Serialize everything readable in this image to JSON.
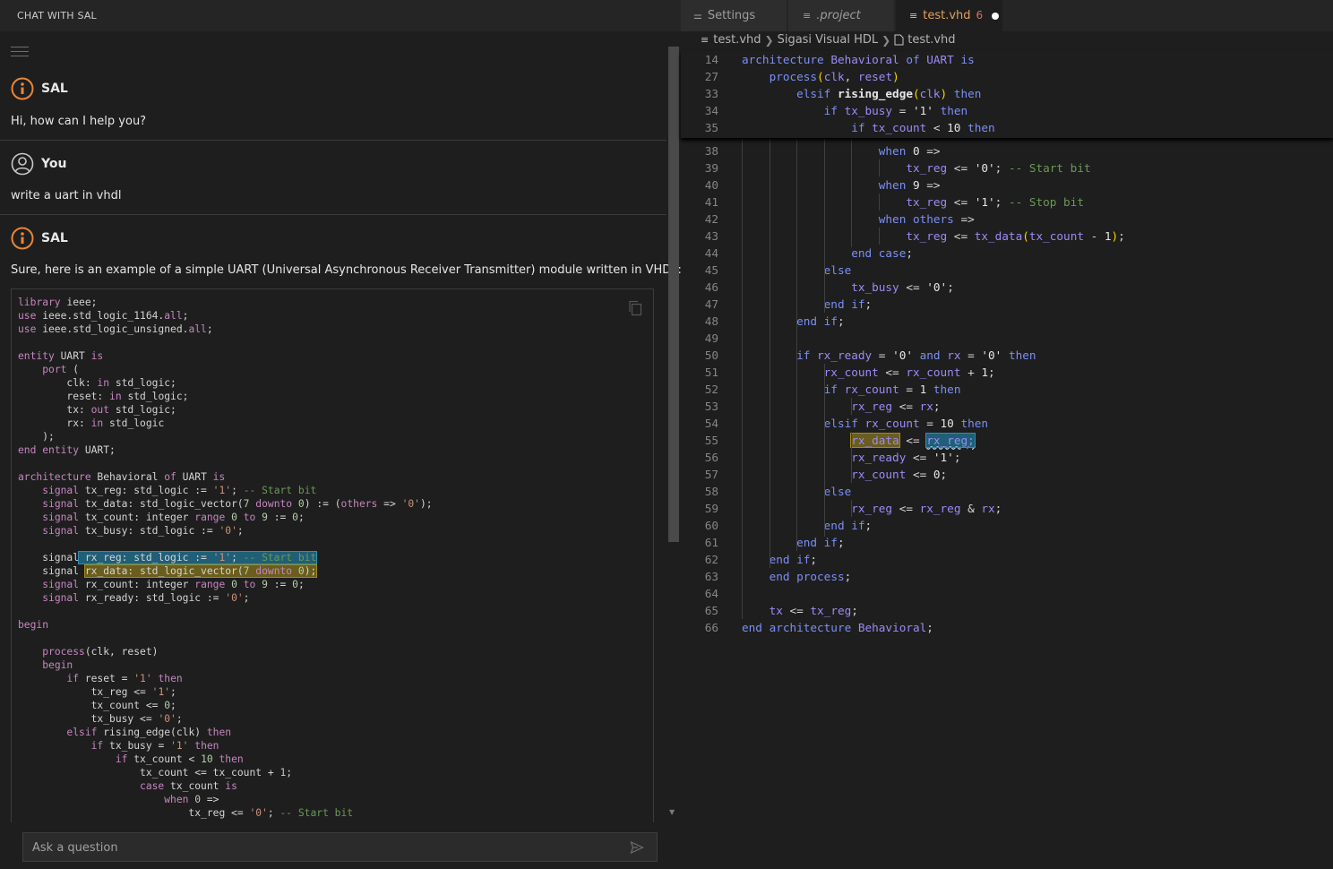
{
  "chat": {
    "header": "CHAT WITH SAL",
    "messages": [
      {
        "author": "SAL",
        "text": "Hi, how can I help you?"
      },
      {
        "author": "You",
        "text": "write a uart in vhdl"
      },
      {
        "author": "SAL",
        "text": "Sure, here is an example of a simple UART (Universal Asynchronous Receiver Transmitter) module written in VHDL:"
      }
    ],
    "code_lines": [
      "library ieee;",
      "use ieee.std_logic_1164.all;",
      "use ieee.std_logic_unsigned.all;",
      "",
      "entity UART is",
      "    port (",
      "        clk: in std_logic;",
      "        reset: in std_logic;",
      "        tx: out std_logic;",
      "        rx: in std_logic",
      "    );",
      "end entity UART;",
      "",
      "architecture Behavioral of UART is",
      "    signal tx_reg: std_logic := '1'; -- Start bit",
      "    signal tx_data: std_logic_vector(7 downto 0) := (others => '0');",
      "    signal tx_count: integer range 0 to 9 := 0;",
      "    signal tx_busy: std_logic := '0';",
      "",
      "    signal rx_reg: std_logic := '1'; -- Start bit",
      "    signal rx_data: std_logic_vector(7 downto 0);",
      "    signal rx_count: integer range 0 to 9 := 0;",
      "    signal rx_ready: std_logic := '0';",
      "",
      "begin",
      "",
      "    process(clk, reset)",
      "    begin",
      "        if reset = '1' then",
      "            tx_reg <= '1';",
      "            tx_count <= 0;",
      "            tx_busy <= '0';",
      "        elsif rising_edge(clk) then",
      "            if tx_busy = '1' then",
      "                if tx_count < 10 then",
      "                    tx_count <= tx_count + 1;",
      "                    case tx_count is",
      "                        when 0 =>",
      "                            tx_reg <= '0'; -- Start bit"
    ],
    "input_placeholder": "Ask a question"
  },
  "editor": {
    "tabs": [
      {
        "label": "Settings",
        "icon": "settings-icon"
      },
      {
        "label": ".project",
        "icon": "file-lines-icon"
      },
      {
        "label": "test.vhd",
        "icon": "file-lines-icon",
        "problems": "6",
        "modified": true
      }
    ],
    "breadcrumb": [
      "test.vhd",
      "Sigasi Visual HDL",
      "test.vhd"
    ],
    "sticky_lines": [
      {
        "n": "14",
        "text": "architecture Behavioral of UART is"
      },
      {
        "n": "27",
        "text": "    process(clk, reset)"
      },
      {
        "n": "33",
        "text": "        elsif rising_edge(clk) then"
      },
      {
        "n": "34",
        "text": "            if tx_busy = '1' then"
      },
      {
        "n": "35",
        "text": "                if tx_count < 10 then"
      }
    ],
    "lines": [
      {
        "n": "38",
        "text": "                    when 0 =>"
      },
      {
        "n": "39",
        "text": "                        tx_reg <= '0'; -- Start bit"
      },
      {
        "n": "40",
        "text": "                    when 9 =>"
      },
      {
        "n": "41",
        "text": "                        tx_reg <= '1'; -- Stop bit"
      },
      {
        "n": "42",
        "text": "                    when others =>"
      },
      {
        "n": "43",
        "text": "                        tx_reg <= tx_data(tx_count - 1);"
      },
      {
        "n": "44",
        "text": "                end case;"
      },
      {
        "n": "45",
        "text": "            else"
      },
      {
        "n": "46",
        "text": "                tx_busy <= '0';"
      },
      {
        "n": "47",
        "text": "            end if;"
      },
      {
        "n": "48",
        "text": "        end if;"
      },
      {
        "n": "49",
        "text": ""
      },
      {
        "n": "50",
        "text": "        if rx_ready = '0' and rx = '0' then"
      },
      {
        "n": "51",
        "text": "            rx_count <= rx_count + 1;"
      },
      {
        "n": "52",
        "text": "            if rx_count = 1 then"
      },
      {
        "n": "53",
        "text": "                rx_reg <= rx;"
      },
      {
        "n": "54",
        "text": "            elsif rx_count = 10 then"
      },
      {
        "n": "55",
        "text": "                rx_data <= rx_reg;"
      },
      {
        "n": "56",
        "text": "                rx_ready <= '1';"
      },
      {
        "n": "57",
        "text": "                rx_count <= 0;"
      },
      {
        "n": "58",
        "text": "            else"
      },
      {
        "n": "59",
        "text": "                rx_reg <= rx_reg & rx;"
      },
      {
        "n": "60",
        "text": "            end if;"
      },
      {
        "n": "61",
        "text": "        end if;"
      },
      {
        "n": "62",
        "text": "    end if;"
      },
      {
        "n": "63",
        "text": "    end process;"
      },
      {
        "n": "64",
        "text": ""
      },
      {
        "n": "65",
        "text": "    tx <= tx_reg;"
      },
      {
        "n": "66",
        "text": "end architecture Behavioral;"
      }
    ]
  },
  "colors": {
    "accent_orange": "#e8863a",
    "keyword": "#7b8ff7",
    "identifier": "#9a8cf7",
    "comment": "#6a9955",
    "highlight_blue": "#1f5f77",
    "highlight_yellow": "#6b5d1b"
  }
}
